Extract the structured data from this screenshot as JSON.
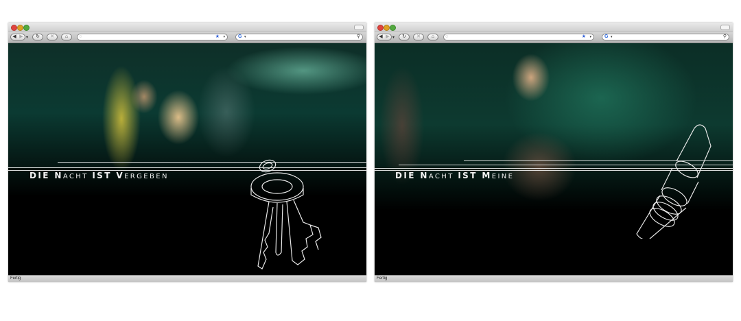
{
  "windows": [
    {
      "toolbar": {
        "back_icon": "◀",
        "forward_icon": "▶",
        "dropdown_icon": "▾",
        "reload_icon": "↻",
        "stop_icon": "✕",
        "home_icon": "⌂"
      },
      "url_bar": {
        "value": "",
        "star_icon": "★",
        "caret_icon": "▾",
        "site_icon": "◌"
      },
      "search_bar": {
        "value": "",
        "engine_icon": "G",
        "caret_icon": "▾",
        "search_icon": "⚲"
      },
      "slogan": {
        "part1": "DIE N",
        "part2": "ACHT ",
        "part3": "IST V",
        "part4": "ERGEBEN"
      },
      "status_text": "Fertig"
    },
    {
      "toolbar": {
        "back_icon": "◀",
        "forward_icon": "▶",
        "dropdown_icon": "▾",
        "reload_icon": "↻",
        "stop_icon": "✕",
        "home_icon": "⌂"
      },
      "url_bar": {
        "value": "",
        "star_icon": "★",
        "caret_icon": "▾",
        "site_icon": "◌"
      },
      "search_bar": {
        "value": "",
        "engine_icon": "G",
        "caret_icon": "▾",
        "search_icon": "⚲"
      },
      "slogan": {
        "part1": "DIE N",
        "part2": "ACHT ",
        "part3": "IST M",
        "part4": "EINE"
      },
      "status_text": "Fertig"
    }
  ],
  "colors": {
    "accent_green": "#0d3a30",
    "line_art": "#e8e8e8",
    "slogan": "#f2f2f2"
  }
}
